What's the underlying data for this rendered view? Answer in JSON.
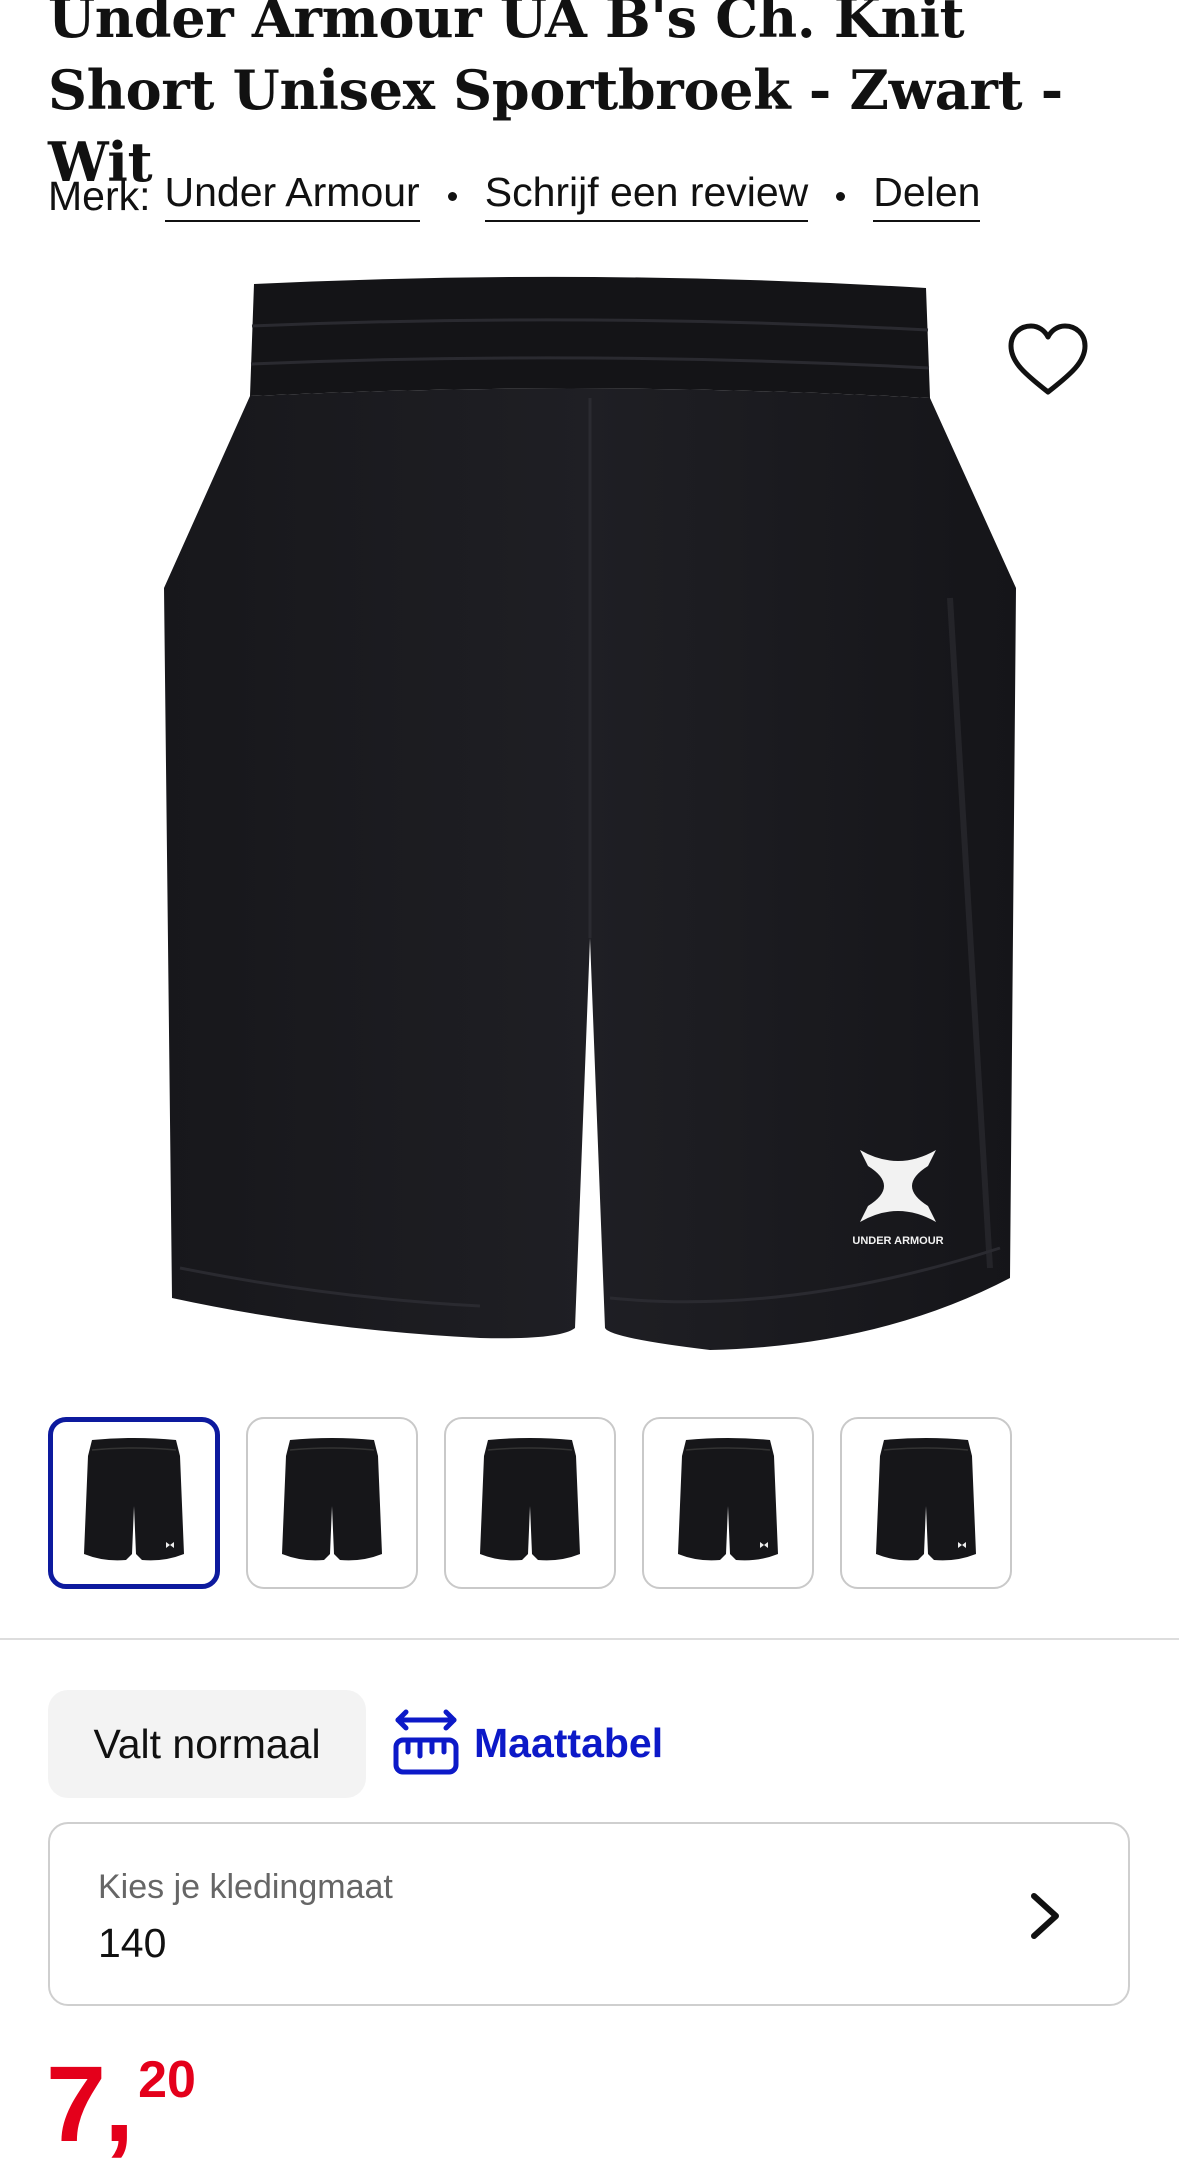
{
  "product": {
    "title": "Under Armour UA B's Ch. Knit Short Unisex Sportbroek - Zwart - Wit",
    "brand_label": "Merk:",
    "brand": "Under Armour",
    "review_link": "Schrijf een review",
    "share_link": "Delen",
    "logo_text": "UNDER ARMOUR"
  },
  "thumbnails": [
    {
      "icon": "shorts-front-thumbnail",
      "selected": true
    },
    {
      "icon": "shorts-back-thumbnail",
      "selected": false
    },
    {
      "icon": "shorts-back-thumbnail",
      "selected": false
    },
    {
      "icon": "shorts-front-thumbnail",
      "selected": false
    },
    {
      "icon": "shorts-front-thumbnail",
      "selected": false
    }
  ],
  "sizing": {
    "fit_label": "Valt normaal",
    "size_chart_label": "Maattabel",
    "select_placeholder": "Kies je kledingmaat",
    "select_value": "140"
  },
  "price": {
    "euros": "7",
    "separator": ",",
    "cents": "20"
  },
  "colors": {
    "accent": "#0c19c8",
    "price": "#e4001b",
    "selected_border": "#0d1a9e"
  }
}
